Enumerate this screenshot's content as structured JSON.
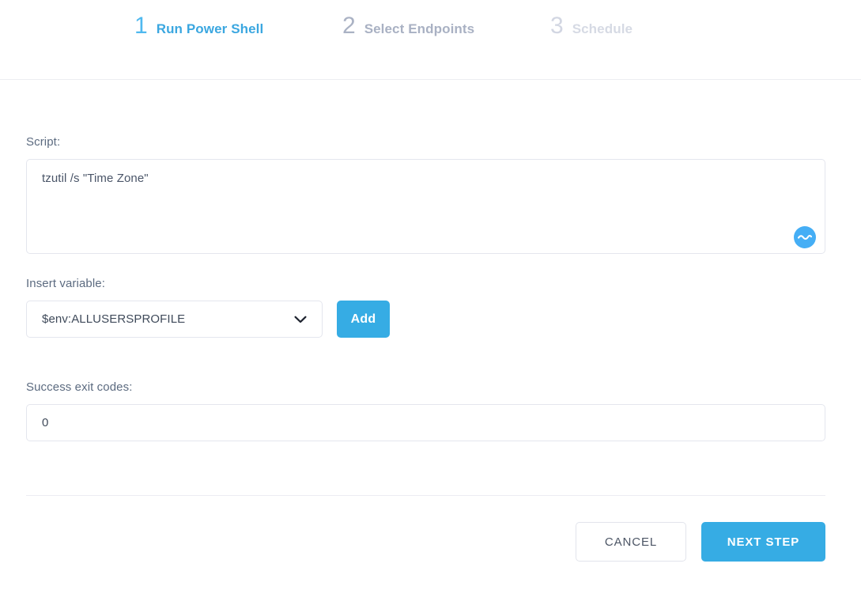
{
  "wizard": {
    "steps": [
      {
        "number": "1",
        "label": "Run Power Shell",
        "state": "active"
      },
      {
        "number": "2",
        "label": "Select Endpoints",
        "state": "pending"
      },
      {
        "number": "3",
        "label": "Schedule",
        "state": "future"
      }
    ]
  },
  "script": {
    "label": "Script:",
    "value": "tzutil /s \"Time Zone\"",
    "placeholder": "",
    "assistant_icon": "wave-circle-icon"
  },
  "insert_variable": {
    "label": "Insert variable:",
    "selected": "$env:ALLUSERSPROFILE",
    "chevron_icon": "chevron-down-icon",
    "add_label": "Add"
  },
  "success_exit_codes": {
    "label": "Success exit codes:",
    "value": "0",
    "placeholder": ""
  },
  "footer": {
    "cancel_label": "CANCEL",
    "next_label": "NEXT STEP"
  },
  "colors": {
    "accent": "#36ace4",
    "active_bar": "#29abe2",
    "active_label": "#3ba7e0",
    "active_number": "#4fb9ef",
    "pending_bar": "#dee1e9",
    "future_bar": "#eceef4",
    "label_text": "#5c6b80",
    "border": "#e4e6ee",
    "assistant_icon": "#45aef5"
  }
}
